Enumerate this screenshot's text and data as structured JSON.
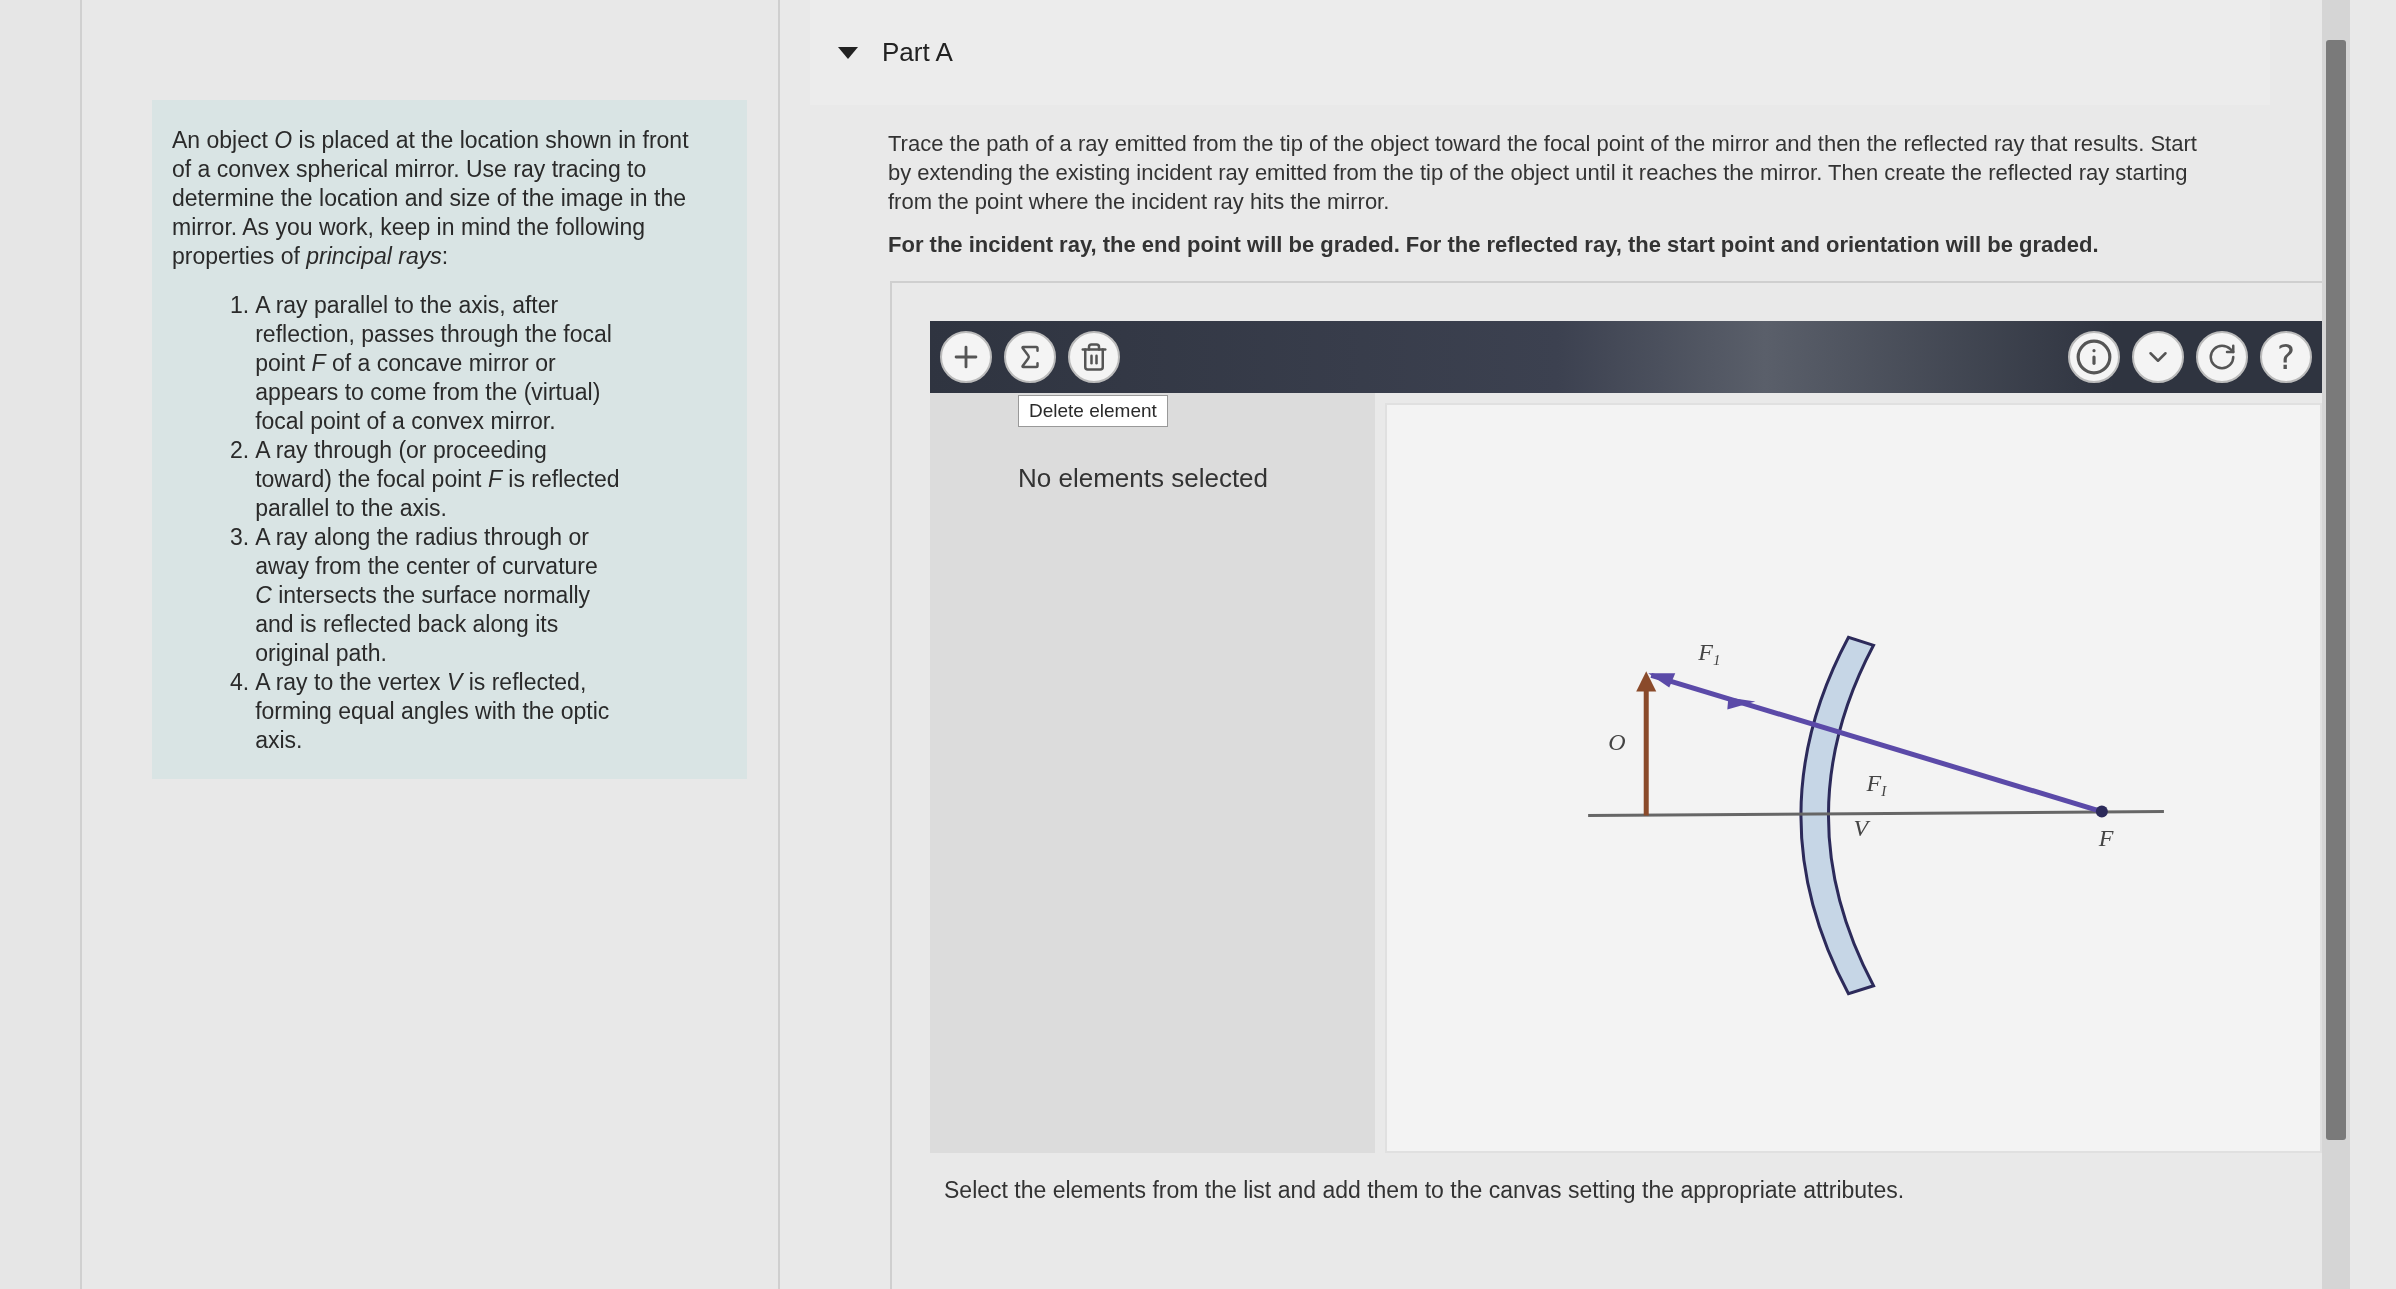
{
  "sidebar": {
    "problem_text": "An object *O* is placed at the location shown in front of a convex spherical mirror. Use ray tracing to determine the location and size of the image in the mirror. As you work, keep in mind the following properties of *principal rays*:",
    "properties": [
      {
        "number": "1.",
        "text": "A ray parallel to the axis, after reflection, passes through the focal point *F* of a concave mirror or appears to come from the (virtual) focal point of a convex mirror."
      },
      {
        "number": "2.",
        "text": "A ray through (or proceeding toward) the focal point *F* is reflected parallel to the axis."
      },
      {
        "number": "3.",
        "text": "A ray along the radius through or away from the center of curvature *C* intersects the surface normally and is reflected back along its original path."
      },
      {
        "number": "4.",
        "text": "A ray to the vertex *V* is reflected, forming equal angles with the optic axis."
      }
    ]
  },
  "part": {
    "title": "Part A",
    "expanded": true
  },
  "instructions": "Trace the path of a ray emitted from the tip of the object toward the focal point of the mirror and then the reflected ray that results. Start by extending the existing incident ray emitted from the tip of the object until it reaches the mirror. Then create the reflected ray starting from the point where the incident ray hits the mirror.",
  "grading_note": "For the incident ray, the end point will be graded. For the reflected ray, the start point and orientation will be graded.",
  "toolbar": {
    "tooltip": "Delete element",
    "question_mark": "?"
  },
  "selection_status": "No elements selected",
  "diagram_labels": [
    {
      "kind": "object",
      "text": "O"
    },
    {
      "kind": "ray",
      "text": "F$_{1}$"
    },
    {
      "kind": "mirror",
      "text": "F$_{I}$"
    },
    {
      "kind": "vertex",
      "text": "V"
    },
    {
      "kind": "focus",
      "text": "F"
    }
  ],
  "footer": "Select the elements from the list and add them to the canvas setting the appropriate attributes."
}
